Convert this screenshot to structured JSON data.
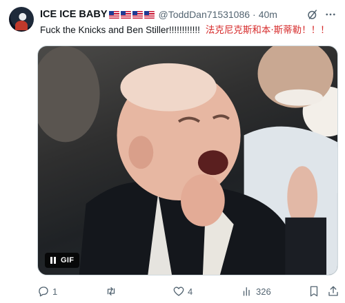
{
  "tweet": {
    "display_name": "ICE ICE BABY",
    "flag_count": 4,
    "handle": "@ToddDan71531086",
    "separator": "·",
    "time": "40m",
    "text_en": "Fuck the Knicks and Ben Stiller!!!!!!!!!!!!",
    "text_cn": "法克尼克斯和本·斯蒂勒！！！"
  },
  "media": {
    "badge_label": "GIF",
    "badge_icon": "pause-icon"
  },
  "actions": {
    "reply": {
      "icon": "reply-icon",
      "count": "1"
    },
    "retweet": {
      "icon": "retweet-icon",
      "count": ""
    },
    "like": {
      "icon": "heart-icon",
      "count": "4"
    },
    "views": {
      "icon": "views-icon",
      "count": "326"
    },
    "bookmark": {
      "icon": "bookmark-icon"
    },
    "share": {
      "icon": "share-icon"
    }
  },
  "colors": {
    "secondary_text": "#536471",
    "chinese_text": "#d62b2b",
    "border": "#cfd9de"
  }
}
